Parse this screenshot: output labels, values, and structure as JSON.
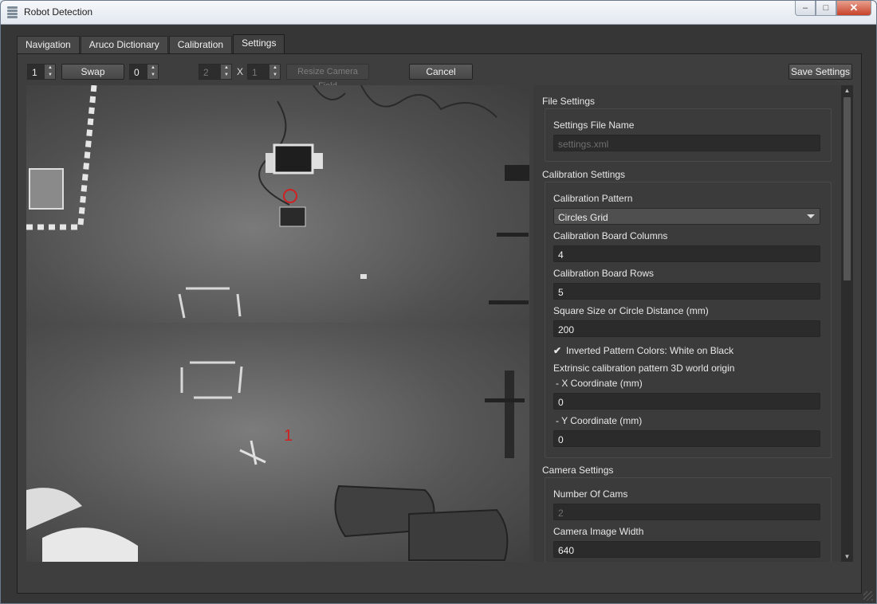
{
  "window": {
    "title": "Robot Detection",
    "minimize_glyph": "–",
    "maximize_glyph": "□",
    "close_glyph": "✕"
  },
  "tabs": [
    {
      "label": "Navigation",
      "active": false
    },
    {
      "label": "Aruco Dictionary",
      "active": false
    },
    {
      "label": "Calibration",
      "active": false
    },
    {
      "label": "Settings",
      "active": true
    }
  ],
  "toolbar": {
    "swap_left_value": "1",
    "swap_label": "Swap",
    "swap_right_value": "0",
    "field_cols_value": "2",
    "x_label": "X",
    "field_rows_value": "1",
    "resize_label": "Resize Camera Field",
    "cancel_label": "Cancel",
    "save_label": "Save Settings"
  },
  "camera": {
    "overlay_id_label": "1"
  },
  "settings": {
    "file": {
      "section_title": "File Settings",
      "file_name_label": "Settings File Name",
      "file_name_placeholder": "settings.xml"
    },
    "calibration": {
      "section_title": "Calibration Settings",
      "pattern_label": "Calibration Pattern",
      "pattern_value": "Circles Grid",
      "columns_label": "Calibration Board Columns",
      "columns_value": "4",
      "rows_label": "Calibration Board Rows",
      "rows_value": "5",
      "square_label": "Square Size or Circle Distance (mm)",
      "square_value": "200",
      "inverted_label": "Inverted Pattern Colors: White on Black",
      "inverted_checked": true,
      "origin_label": "Extrinsic calibration pattern 3D world origin",
      "x_coord_label": "- X Coordinate (mm)",
      "x_coord_value": "0",
      "y_coord_label": "- Y Coordinate (mm)",
      "y_coord_value": "0"
    },
    "camera": {
      "section_title": "Camera Settings",
      "num_cams_label": "Number Of Cams",
      "num_cams_value": "2",
      "image_width_label": "Camera Image Width",
      "image_width_value": "640"
    }
  },
  "icons": {
    "check": "✔",
    "spin_up": "▲",
    "spin_down": "▼"
  },
  "colors": {
    "panel_bg": "#3e3e3e",
    "field_bg": "#2b2b2b",
    "marker_red": "#d02020"
  }
}
